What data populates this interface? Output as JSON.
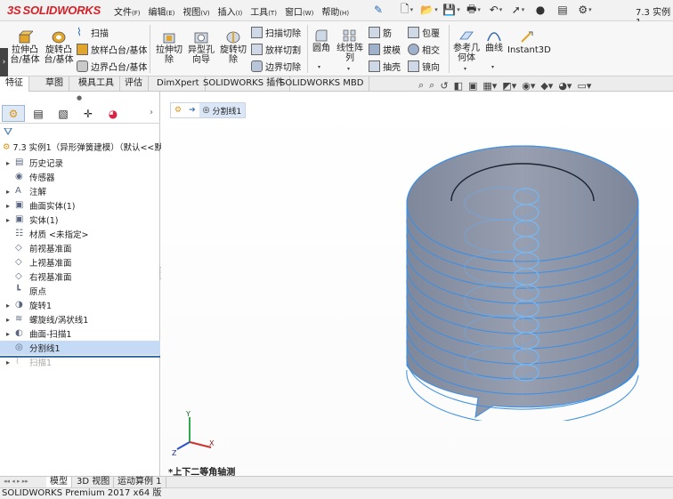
{
  "app": {
    "logo_text": "SOLIDWORKS",
    "logo_mark": "3S",
    "document_title": "7.3 实例1",
    "status_text": "SOLIDWORKS Premium 2017 x64 版"
  },
  "menu": [
    {
      "label": "文件",
      "key": "(F)"
    },
    {
      "label": "编辑",
      "key": "(E)"
    },
    {
      "label": "视图",
      "key": "(V)"
    },
    {
      "label": "插入",
      "key": "(I)"
    },
    {
      "label": "工具",
      "key": "(T)"
    },
    {
      "label": "窗口",
      "key": "(W)"
    },
    {
      "label": "帮助",
      "key": "(H)"
    }
  ],
  "commands": {
    "extrude_boss": "拉伸凸\n台/基体",
    "revolve_boss": "旋转凸\n台/基体",
    "sweep": "扫描",
    "loft_boss": "放样凸台/基体",
    "boundary_boss": "边界凸台/基体",
    "extrude_cut": "拉伸切\n除",
    "hole_wizard": "异型孔\n向导",
    "revolve_cut": "旋转切\n除",
    "sweep_cut": "扫描切除",
    "loft_cut": "放样切割",
    "boundary_cut": "边界切除",
    "fillet": "圆角",
    "linear_pattern": "线性阵\n列",
    "rib": "筋",
    "draft": "拔模",
    "shell": "抽壳",
    "wrap": "包覆",
    "intersect": "相交",
    "mirror": "镜向",
    "reference_geometry": "参考几\n何体",
    "curves": "曲线",
    "instant3d": "Instant3D"
  },
  "tabs": [
    {
      "label": "特征",
      "active": true
    },
    {
      "label": "草图",
      "active": false
    },
    {
      "label": "模具工具",
      "active": false
    },
    {
      "label": "评估",
      "active": false
    },
    {
      "label": "DimXpert",
      "active": false
    },
    {
      "label": "SOLIDWORKS 插件",
      "active": false
    },
    {
      "label": "SOLIDWORKS MBD",
      "active": false
    }
  ],
  "feature_tree": {
    "root": "7.3 实例1（异形弹簧建模）（默认<<默认",
    "nodes": [
      {
        "label": "历史记录",
        "expand": "▸",
        "icon": "history-icon"
      },
      {
        "label": "传感器",
        "expand": "",
        "icon": "sensor-icon"
      },
      {
        "label": "注解",
        "expand": "▸",
        "icon": "annotation-icon"
      },
      {
        "label": "曲面实体(1)",
        "expand": "▸",
        "icon": "surface-bodies-icon"
      },
      {
        "label": "实体(1)",
        "expand": "▸",
        "icon": "solid-bodies-icon"
      },
      {
        "label": "材质 <未指定>",
        "expand": "",
        "icon": "material-icon"
      },
      {
        "label": "前视基准面",
        "expand": "",
        "icon": "plane-icon"
      },
      {
        "label": "上视基准面",
        "expand": "",
        "icon": "plane-icon"
      },
      {
        "label": "右视基准面",
        "expand": "",
        "icon": "plane-icon"
      },
      {
        "label": "原点",
        "expand": "",
        "icon": "origin-icon"
      },
      {
        "label": "旋转1",
        "expand": "▸",
        "icon": "revolve-icon"
      },
      {
        "label": "螺旋线/涡状线1",
        "expand": "▸",
        "icon": "helix-icon"
      },
      {
        "label": "曲面-扫描1",
        "expand": "▸",
        "icon": "surface-sweep-icon"
      },
      {
        "label": "分割线1",
        "expand": "",
        "icon": "split-line-icon",
        "selected": true
      },
      {
        "label": "扫描1",
        "expand": "▸",
        "icon": "sweep-icon",
        "disabled": true
      }
    ]
  },
  "breadcrumb": {
    "current": "分割线1"
  },
  "view_label": "*上下二等角轴测",
  "bottom_tabs": [
    {
      "label": "模型",
      "active": true
    },
    {
      "label": "3D 视图",
      "active": false
    },
    {
      "label": "运动算例 1",
      "active": false
    }
  ],
  "triad": {
    "x": "X",
    "y": "Y",
    "z": "Z"
  },
  "colors": {
    "model_fill": "#8c94a6",
    "model_edge": "#3a8fe6",
    "selection": "#c5dbf5",
    "logo_red": "#d42027"
  }
}
